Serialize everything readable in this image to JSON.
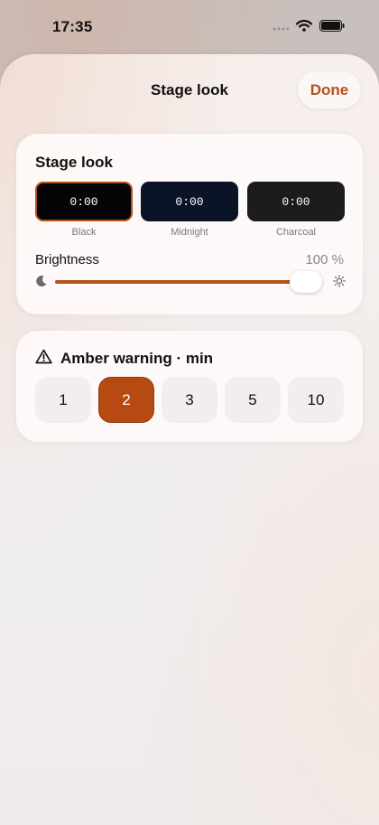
{
  "status_bar": {
    "time": "17:35",
    "icons": [
      "signal-icon",
      "wifi-icon",
      "battery-icon"
    ]
  },
  "sheet": {
    "title": "Stage look",
    "done_label": "Done"
  },
  "stage_look": {
    "heading": "Stage look",
    "swatches": [
      {
        "name": "Black",
        "preview": "0:00",
        "color": "#050505",
        "selected": true
      },
      {
        "name": "Midnight",
        "preview": "0:00",
        "color": "#0b1326",
        "selected": false
      },
      {
        "name": "Charcoal",
        "preview": "0:00",
        "color": "#1c1c1e",
        "selected": false
      }
    ],
    "brightness": {
      "label": "Brightness",
      "value_text": "100 %",
      "value": 1.0,
      "min_icon": "moon-icon",
      "max_icon": "sun-icon"
    }
  },
  "amber_warning": {
    "icon": "warning-triangle-icon",
    "heading": "Amber warning · min",
    "options": [
      "1",
      "2",
      "3",
      "5",
      "10"
    ],
    "selected": "2"
  },
  "colors": {
    "accent": "#b5501f"
  }
}
